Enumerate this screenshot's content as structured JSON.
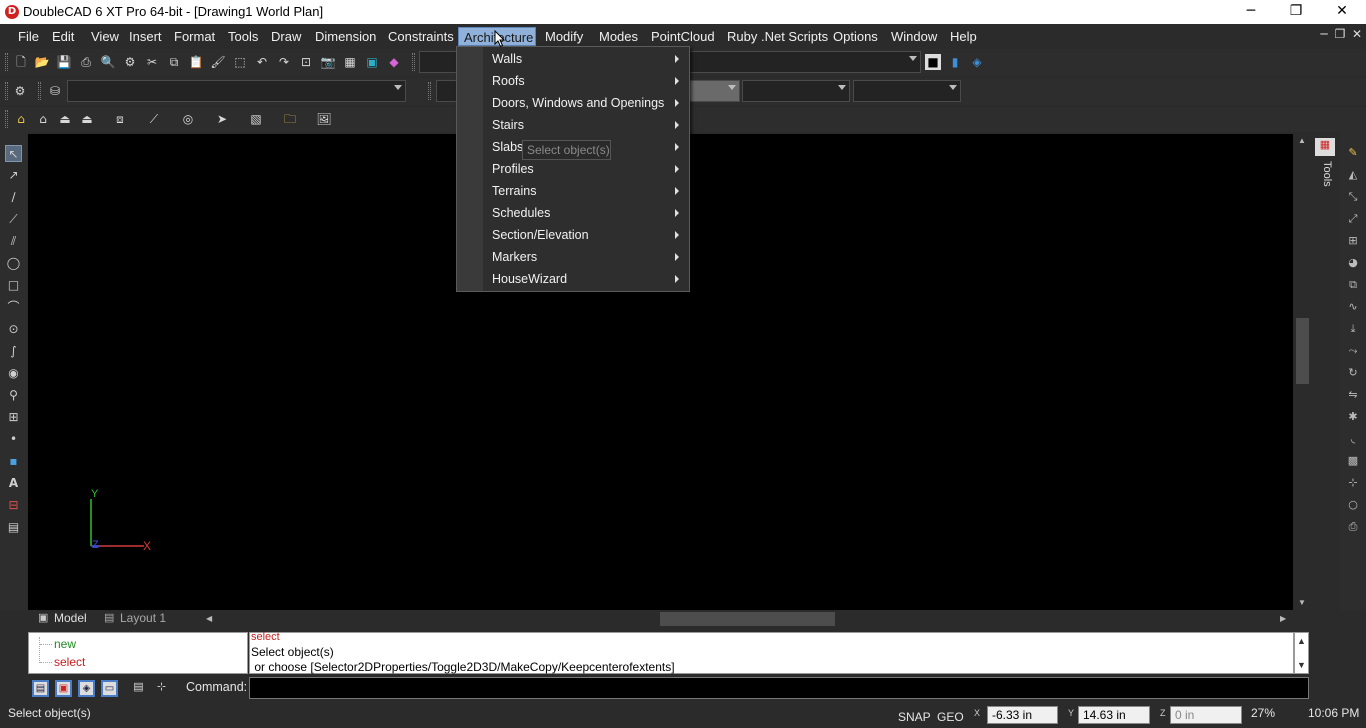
{
  "window": {
    "logo_letter": "D",
    "title": "DoubleCAD 6 XT Pro 64-bit - [Drawing1 World Plan]",
    "minimize": "─",
    "restore": "❐",
    "close": "✕"
  },
  "menubar": {
    "items": [
      {
        "label": "File"
      },
      {
        "label": "Edit"
      },
      {
        "label": "View"
      },
      {
        "label": "Insert"
      },
      {
        "label": "Format"
      },
      {
        "label": "Tools"
      },
      {
        "label": "Draw"
      },
      {
        "label": "Dimension"
      },
      {
        "label": "Constraints"
      },
      {
        "label": "Architecture"
      },
      {
        "label": "Modify"
      },
      {
        "label": "Modes"
      },
      {
        "label": "PointCloud"
      },
      {
        "label": "Ruby .Net Scripts"
      },
      {
        "label": "Options"
      },
      {
        "label": "Window"
      },
      {
        "label": "Help"
      }
    ],
    "active": "Architecture"
  },
  "architecture_menu": {
    "items": [
      {
        "label": "Walls",
        "submenu": true
      },
      {
        "label": "Roofs",
        "submenu": true
      },
      {
        "label": "Doors, Windows and Openings",
        "submenu": true
      },
      {
        "label": "Stairs",
        "submenu": true
      },
      {
        "label": "Slabs",
        "submenu": true
      },
      {
        "label": "Profiles",
        "submenu": true
      },
      {
        "label": "Terrains",
        "submenu": true
      },
      {
        "label": "Schedules",
        "submenu": true
      },
      {
        "label": "Section/Elevation",
        "submenu": true
      },
      {
        "label": "Markers",
        "submenu": true
      },
      {
        "label": "HouseWizard",
        "submenu": true
      }
    ]
  },
  "tooltip": "Select object(s)",
  "tools_panel_label": "Tools",
  "axes": {
    "y": "Y",
    "x": "X",
    "z": "Z"
  },
  "tabs": [
    {
      "label": "Model",
      "active": true
    },
    {
      "label": "Layout 1",
      "active": false
    }
  ],
  "command_history": {
    "items": [
      {
        "label": "new",
        "color": "#1f8f1f"
      },
      {
        "label": "select",
        "color": "#c81e1e"
      }
    ]
  },
  "command_output": {
    "line1": "select",
    "line2": "Select object(s)",
    "line3": " or choose [Selector2DProperties/Toggle2D3D/MakeCopy/Keepcenterofextents]"
  },
  "command_label": "Command:",
  "statusbar": {
    "message": "Select object(s)",
    "snap": "SNAP",
    "geo": "GEO",
    "x_label": "X",
    "x_value": "-6.33 in",
    "y_label": "Y",
    "y_value": "14.63 in",
    "z_label": "Z",
    "z_value": "0 in",
    "zoom": "27%",
    "clock": "10:06 PM"
  },
  "colors": {
    "active_menu": "#8fb1da",
    "canvas": "#000000",
    "x_axis": "#d23a3a",
    "y_axis": "#2fbf2f",
    "z_axis": "#3a50e0"
  }
}
